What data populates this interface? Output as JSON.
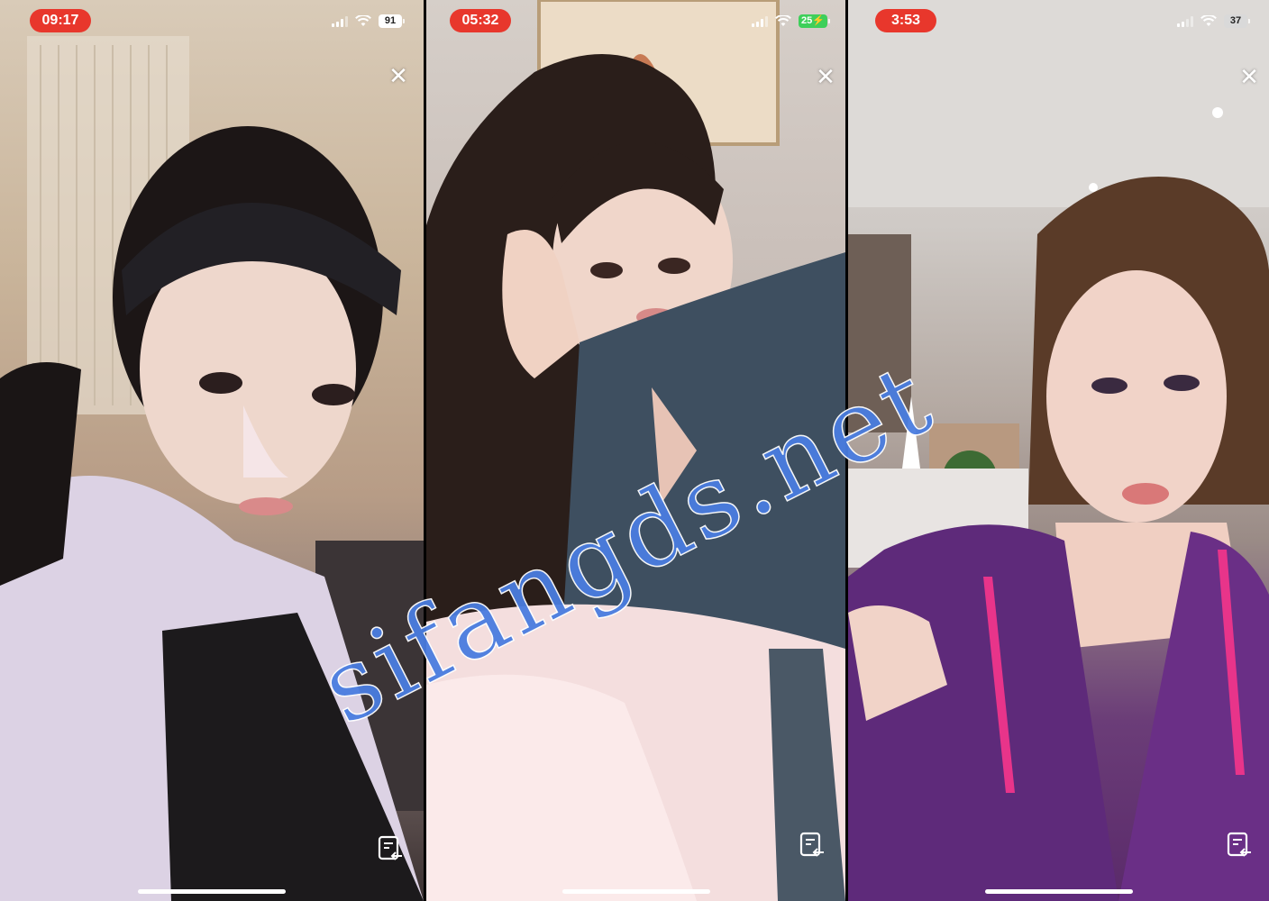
{
  "panels": [
    {
      "time": "09:17",
      "battery": "91",
      "charging": false
    },
    {
      "time": "05:32",
      "battery": "25",
      "charging": true
    },
    {
      "time": "3:53",
      "battery": "37",
      "charging": false
    }
  ],
  "close_symbol": "✕",
  "watermark": "sifangds.net",
  "icons": [
    "signal-icon",
    "wifi-icon",
    "battery-icon",
    "close-icon",
    "note-icon"
  ]
}
